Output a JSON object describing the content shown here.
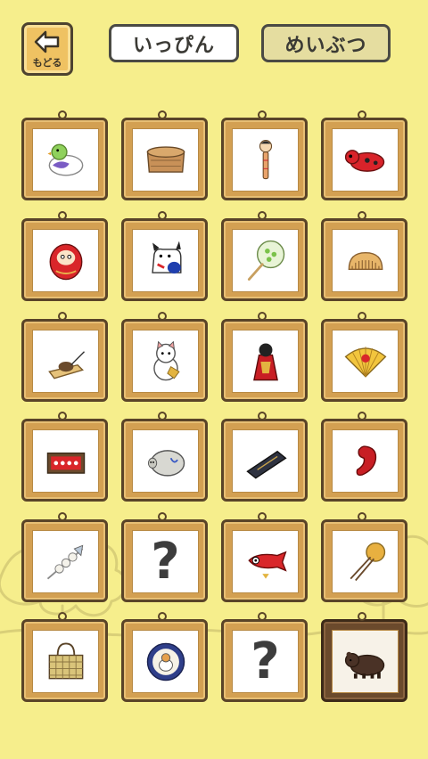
{
  "header": {
    "back_label": "もどる",
    "tabs": [
      {
        "label": "いっぴん",
        "active": true
      },
      {
        "label": "めいぶつ",
        "active": false
      }
    ]
  },
  "colors": {
    "background": "#f6ee8c",
    "frame_wood": "#d3a052",
    "frame_dark": "#5a4428",
    "tab_active": "#ffffff",
    "tab_inactive": "#e5dda0"
  },
  "items": [
    {
      "icon": "pigeon-whistle-icon",
      "unknown": false
    },
    {
      "icon": "bento-box-icon",
      "unknown": false
    },
    {
      "icon": "kokeshi-doll-icon",
      "unknown": false
    },
    {
      "icon": "akabeko-cow-icon",
      "unknown": false
    },
    {
      "icon": "daruma-icon",
      "unknown": false
    },
    {
      "icon": "inu-hariko-dog-icon",
      "unknown": false
    },
    {
      "icon": "uchiwa-fan-icon",
      "unknown": false
    },
    {
      "icon": "comb-icon",
      "unknown": false
    },
    {
      "icon": "mousetrap-icon",
      "unknown": false
    },
    {
      "icon": "maneki-neko-icon",
      "unknown": false
    },
    {
      "icon": "red-figure-icon",
      "unknown": false
    },
    {
      "icon": "folding-fan-icon",
      "unknown": false
    },
    {
      "icon": "matchbox-icon",
      "unknown": false
    },
    {
      "icon": "boar-incense-holder-icon",
      "unknown": false
    },
    {
      "icon": "black-case-icon",
      "unknown": false
    },
    {
      "icon": "red-magatama-icon",
      "unknown": false
    },
    {
      "icon": "pearl-hair-ornament-icon",
      "unknown": false
    },
    {
      "icon": "question-mark-icon",
      "unknown": true,
      "text": "?"
    },
    {
      "icon": "carp-streamer-icon",
      "unknown": false
    },
    {
      "icon": "kanzashi-hairpin-icon",
      "unknown": false
    },
    {
      "icon": "woven-basket-bag-icon",
      "unknown": false
    },
    {
      "icon": "cat-plate-icon",
      "unknown": false
    },
    {
      "icon": "question-mark-icon",
      "unknown": true,
      "text": "?"
    },
    {
      "icon": "bear-carving-icon",
      "unknown": false,
      "selected": true
    }
  ]
}
